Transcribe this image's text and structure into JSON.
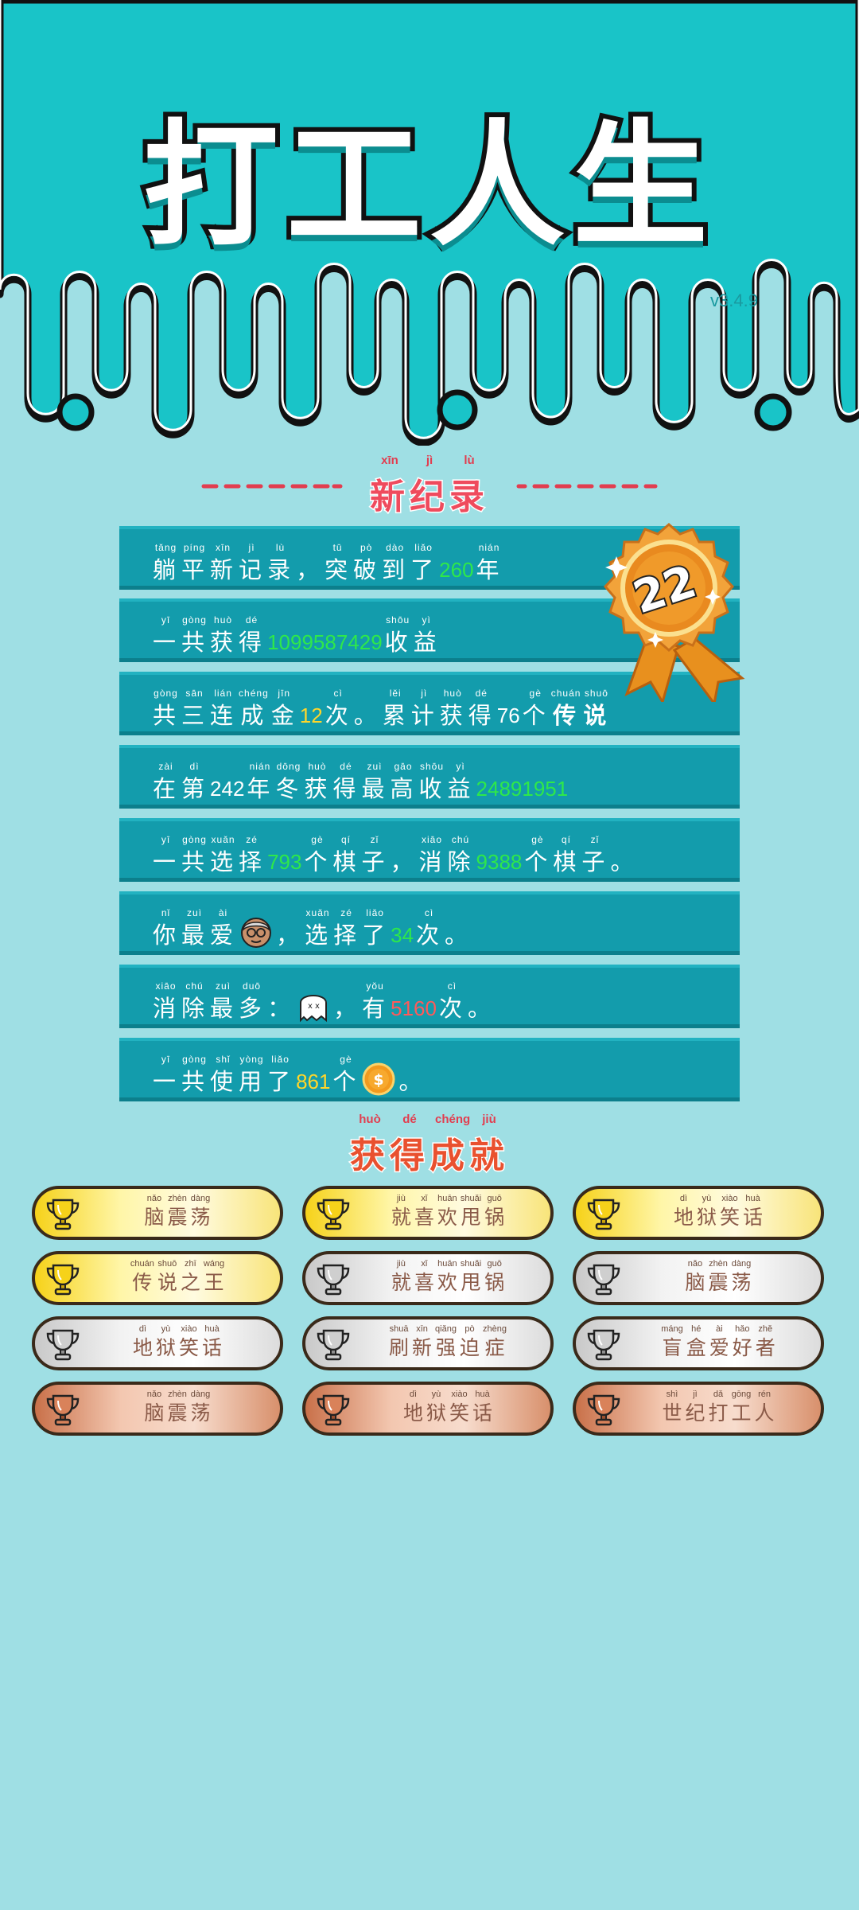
{
  "header": {
    "title": "打工人生",
    "version": "v3.4.9"
  },
  "record_section": {
    "title": [
      {
        "py": "xīn",
        "hz": "新"
      },
      {
        "py": "jì",
        "hz": "纪"
      },
      {
        "py": "lù",
        "hz": "录"
      }
    ]
  },
  "badge": {
    "number": "22"
  },
  "stats": [
    {
      "segs": [
        {
          "t": "c",
          "py": "tǎng",
          "hz": "躺"
        },
        {
          "t": "c",
          "py": "píng",
          "hz": "平"
        },
        {
          "t": "c",
          "py": "xīn",
          "hz": "新"
        },
        {
          "t": "c",
          "py": "jì",
          "hz": "记"
        },
        {
          "t": "c",
          "py": "lù",
          "hz": "录"
        },
        {
          "t": "c",
          "py": "",
          "hz": "，"
        },
        {
          "t": "c",
          "py": "tū",
          "hz": "突"
        },
        {
          "t": "c",
          "py": "pò",
          "hz": "破"
        },
        {
          "t": "c",
          "py": "dào",
          "hz": "到"
        },
        {
          "t": "c",
          "py": "liǎo",
          "hz": "了"
        },
        {
          "t": "n",
          "v": "260",
          "c": "green"
        },
        {
          "t": "c",
          "py": "nián",
          "hz": "年"
        }
      ]
    },
    {
      "segs": [
        {
          "t": "c",
          "py": "yī",
          "hz": "一"
        },
        {
          "t": "c",
          "py": "gòng",
          "hz": "共"
        },
        {
          "t": "c",
          "py": "huò",
          "hz": "获"
        },
        {
          "t": "c",
          "py": "dé",
          "hz": "得"
        },
        {
          "t": "n",
          "v": "1099587429",
          "c": "green"
        },
        {
          "t": "c",
          "py": "shōu",
          "hz": "收"
        },
        {
          "t": "c",
          "py": "yì",
          "hz": "益"
        }
      ]
    },
    {
      "segs": [
        {
          "t": "c",
          "py": "gòng",
          "hz": "共"
        },
        {
          "t": "c",
          "py": "sān",
          "hz": "三"
        },
        {
          "t": "c",
          "py": "lián",
          "hz": "连"
        },
        {
          "t": "c",
          "py": "chéng",
          "hz": "成"
        },
        {
          "t": "c",
          "py": "jīn",
          "hz": "金"
        },
        {
          "t": "n",
          "v": "12",
          "c": "yellow"
        },
        {
          "t": "c",
          "py": "cì",
          "hz": "次"
        },
        {
          "t": "c",
          "py": "",
          "hz": "。"
        },
        {
          "t": "c",
          "py": "lěi",
          "hz": "累"
        },
        {
          "t": "c",
          "py": "jì",
          "hz": "计"
        },
        {
          "t": "c",
          "py": "huò",
          "hz": "获"
        },
        {
          "t": "c",
          "py": "dé",
          "hz": "得"
        },
        {
          "t": "n",
          "v": "76",
          "c": "white"
        },
        {
          "t": "c",
          "py": "gè",
          "hz": "个"
        },
        {
          "t": "c",
          "py": "chuán",
          "hz": "传",
          "c": "legend"
        },
        {
          "t": "c",
          "py": "shuō",
          "hz": "说",
          "c": "legend"
        }
      ]
    },
    {
      "segs": [
        {
          "t": "c",
          "py": "zài",
          "hz": "在"
        },
        {
          "t": "c",
          "py": "dì",
          "hz": "第"
        },
        {
          "t": "n",
          "v": "242",
          "c": "white"
        },
        {
          "t": "c",
          "py": "nián",
          "hz": "年"
        },
        {
          "t": "c",
          "py": "dōng",
          "hz": "冬"
        },
        {
          "t": "c",
          "py": "huò",
          "hz": "获"
        },
        {
          "t": "c",
          "py": "dé",
          "hz": "得"
        },
        {
          "t": "c",
          "py": "zuì",
          "hz": "最"
        },
        {
          "t": "c",
          "py": "gāo",
          "hz": "高"
        },
        {
          "t": "c",
          "py": "shōu",
          "hz": "收"
        },
        {
          "t": "c",
          "py": "yì",
          "hz": "益"
        },
        {
          "t": "n",
          "v": "24891951",
          "c": "green"
        }
      ]
    },
    {
      "segs": [
        {
          "t": "c",
          "py": "yī",
          "hz": "一"
        },
        {
          "t": "c",
          "py": "gòng",
          "hz": "共"
        },
        {
          "t": "c",
          "py": "xuǎn",
          "hz": "选"
        },
        {
          "t": "c",
          "py": "zé",
          "hz": "择"
        },
        {
          "t": "n",
          "v": "793",
          "c": "green"
        },
        {
          "t": "c",
          "py": "gè",
          "hz": "个"
        },
        {
          "t": "c",
          "py": "qí",
          "hz": "棋"
        },
        {
          "t": "c",
          "py": "zǐ",
          "hz": "子"
        },
        {
          "t": "c",
          "py": "",
          "hz": "，"
        },
        {
          "t": "c",
          "py": "xiāo",
          "hz": "消"
        },
        {
          "t": "c",
          "py": "chú",
          "hz": "除"
        },
        {
          "t": "n",
          "v": "9388",
          "c": "green"
        },
        {
          "t": "c",
          "py": "gè",
          "hz": "个"
        },
        {
          "t": "c",
          "py": "qí",
          "hz": "棋"
        },
        {
          "t": "c",
          "py": "zǐ",
          "hz": "子"
        },
        {
          "t": "c",
          "py": "",
          "hz": "。"
        }
      ]
    },
    {
      "segs": [
        {
          "t": "c",
          "py": "nǐ",
          "hz": "你"
        },
        {
          "t": "c",
          "py": "zuì",
          "hz": "最"
        },
        {
          "t": "c",
          "py": "ài",
          "hz": "爱"
        },
        {
          "t": "i",
          "icon": "old-man-face-icon"
        },
        {
          "t": "c",
          "py": "",
          "hz": "，"
        },
        {
          "t": "c",
          "py": "xuǎn",
          "hz": "选"
        },
        {
          "t": "c",
          "py": "zé",
          "hz": "择"
        },
        {
          "t": "c",
          "py": "liǎo",
          "hz": "了"
        },
        {
          "t": "n",
          "v": "34",
          "c": "green"
        },
        {
          "t": "c",
          "py": "cì",
          "hz": "次"
        },
        {
          "t": "c",
          "py": "",
          "hz": "。"
        }
      ]
    },
    {
      "segs": [
        {
          "t": "c",
          "py": "xiāo",
          "hz": "消"
        },
        {
          "t": "c",
          "py": "chú",
          "hz": "除"
        },
        {
          "t": "c",
          "py": "zuì",
          "hz": "最"
        },
        {
          "t": "c",
          "py": "duō",
          "hz": "多"
        },
        {
          "t": "c",
          "py": "",
          "hz": "："
        },
        {
          "t": "i",
          "icon": "ghost-icon"
        },
        {
          "t": "c",
          "py": "",
          "hz": "，"
        },
        {
          "t": "c",
          "py": "yǒu",
          "hz": "有"
        },
        {
          "t": "n",
          "v": "5160",
          "c": "red"
        },
        {
          "t": "c",
          "py": "cì",
          "hz": "次"
        },
        {
          "t": "c",
          "py": "",
          "hz": "。"
        }
      ]
    },
    {
      "segs": [
        {
          "t": "c",
          "py": "yī",
          "hz": "一"
        },
        {
          "t": "c",
          "py": "gòng",
          "hz": "共"
        },
        {
          "t": "c",
          "py": "shǐ",
          "hz": "使"
        },
        {
          "t": "c",
          "py": "yòng",
          "hz": "用"
        },
        {
          "t": "c",
          "py": "liǎo",
          "hz": "了"
        },
        {
          "t": "n",
          "v": "861",
          "c": "yellow"
        },
        {
          "t": "c",
          "py": "gè",
          "hz": "个"
        },
        {
          "t": "i",
          "icon": "coin-icon"
        },
        {
          "t": "c",
          "py": "",
          "hz": "。"
        }
      ]
    }
  ],
  "achievement_section": {
    "title": [
      {
        "py": "huò",
        "hz": "获"
      },
      {
        "py": "dé",
        "hz": "得"
      },
      {
        "py": "chéng",
        "hz": "成"
      },
      {
        "py": "jiù",
        "hz": "就"
      }
    ]
  },
  "achievements": [
    {
      "tier": "gold",
      "chars": [
        {
          "py": "nǎo",
          "hz": "脑"
        },
        {
          "py": "zhèn",
          "hz": "震"
        },
        {
          "py": "dàng",
          "hz": "荡"
        }
      ]
    },
    {
      "tier": "gold",
      "chars": [
        {
          "py": "jiù",
          "hz": "就"
        },
        {
          "py": "xǐ",
          "hz": "喜"
        },
        {
          "py": "huān",
          "hz": "欢"
        },
        {
          "py": "shuǎi",
          "hz": "甩"
        },
        {
          "py": "guō",
          "hz": "锅"
        }
      ]
    },
    {
      "tier": "gold",
      "chars": [
        {
          "py": "dì",
          "hz": "地"
        },
        {
          "py": "yù",
          "hz": "狱"
        },
        {
          "py": "xiào",
          "hz": "笑"
        },
        {
          "py": "huà",
          "hz": "话"
        }
      ]
    },
    {
      "tier": "gold",
      "chars": [
        {
          "py": "chuán",
          "hz": "传"
        },
        {
          "py": "shuō",
          "hz": "说"
        },
        {
          "py": "zhī",
          "hz": "之"
        },
        {
          "py": "wáng",
          "hz": "王"
        }
      ]
    },
    {
      "tier": "silver",
      "chars": [
        {
          "py": "jiù",
          "hz": "就"
        },
        {
          "py": "xǐ",
          "hz": "喜"
        },
        {
          "py": "huān",
          "hz": "欢"
        },
        {
          "py": "shuǎi",
          "hz": "甩"
        },
        {
          "py": "guō",
          "hz": "锅"
        }
      ]
    },
    {
      "tier": "silver",
      "chars": [
        {
          "py": "nǎo",
          "hz": "脑"
        },
        {
          "py": "zhèn",
          "hz": "震"
        },
        {
          "py": "dàng",
          "hz": "荡"
        }
      ]
    },
    {
      "tier": "silver",
      "chars": [
        {
          "py": "dì",
          "hz": "地"
        },
        {
          "py": "yù",
          "hz": "狱"
        },
        {
          "py": "xiào",
          "hz": "笑"
        },
        {
          "py": "huà",
          "hz": "话"
        }
      ]
    },
    {
      "tier": "silver",
      "chars": [
        {
          "py": "shuā",
          "hz": "刷"
        },
        {
          "py": "xīn",
          "hz": "新"
        },
        {
          "py": "qiǎng",
          "hz": "强"
        },
        {
          "py": "pò",
          "hz": "迫"
        },
        {
          "py": "zhèng",
          "hz": "症"
        }
      ]
    },
    {
      "tier": "silver",
      "chars": [
        {
          "py": "máng",
          "hz": "盲"
        },
        {
          "py": "hé",
          "hz": "盒"
        },
        {
          "py": "ài",
          "hz": "爱"
        },
        {
          "py": "hǎo",
          "hz": "好"
        },
        {
          "py": "zhě",
          "hz": "者"
        }
      ]
    },
    {
      "tier": "bronze",
      "chars": [
        {
          "py": "nǎo",
          "hz": "脑"
        },
        {
          "py": "zhèn",
          "hz": "震"
        },
        {
          "py": "dàng",
          "hz": "荡"
        }
      ]
    },
    {
      "tier": "bronze",
      "chars": [
        {
          "py": "dì",
          "hz": "地"
        },
        {
          "py": "yù",
          "hz": "狱"
        },
        {
          "py": "xiào",
          "hz": "笑"
        },
        {
          "py": "huà",
          "hz": "话"
        }
      ]
    },
    {
      "tier": "bronze",
      "chars": [
        {
          "py": "shì",
          "hz": "世"
        },
        {
          "py": "jì",
          "hz": "纪"
        },
        {
          "py": "dǎ",
          "hz": "打"
        },
        {
          "py": "gōng",
          "hz": "工"
        },
        {
          "py": "rén",
          "hz": "人"
        }
      ]
    }
  ],
  "colors": {
    "sky": "#19c4c8",
    "bg": "#9fdfe4",
    "row": "#139cac",
    "green": "#2ee84a",
    "yellow": "#ffd62a",
    "red": "#ff5a5a",
    "gold": "#f6d21a",
    "silver": "#d6d6d6",
    "bronze": "#c9714a"
  }
}
